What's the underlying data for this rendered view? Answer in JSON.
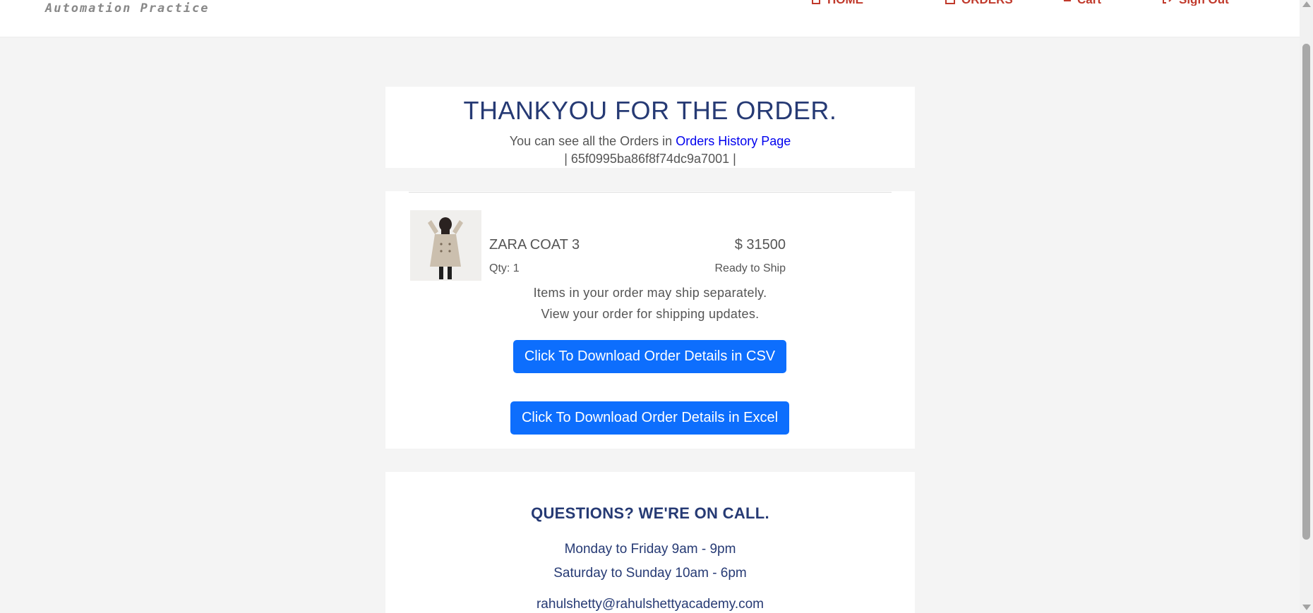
{
  "header": {
    "brand": "Automation Practice",
    "nav": {
      "home": "HOME",
      "orders": "ORDERS",
      "cart": "Cart",
      "signout": "Sign Out"
    },
    "nav_icons": [
      "home-icon",
      "handbag-icon",
      "cart-icon",
      "signout-icon"
    ]
  },
  "confirmation": {
    "title": "THANKYOU FOR THE ORDER.",
    "orders_prefix": "You can see all the Orders in",
    "orders_link": "Orders History Page",
    "order_id_line": "| 65f0995ba86f8f74dc9a7001 |"
  },
  "order_item": {
    "name": "ZARA COAT 3",
    "price": "$ 31500",
    "qty": "Qty: 1",
    "status": "Ready to Ship"
  },
  "shipping": {
    "note1": "Items in your order may ship separately.",
    "note2": "View your order for shipping updates."
  },
  "buttons": {
    "csv": "Click To Download Order Details in CSV",
    "excel": "Click To Download Order Details in Excel"
  },
  "help": {
    "title": "QUESTIONS? WE'RE ON CALL.",
    "weekday": "Monday to Friday 9am - 9pm",
    "weekend": "Saturday to Sunday 10am - 6pm",
    "email": "rahulshetty@rahulshettyacademy.com"
  },
  "colors": {
    "accent": "#0d6efd",
    "title": "#263a74",
    "nav": "#c0392b",
    "link": "#0000ee"
  }
}
